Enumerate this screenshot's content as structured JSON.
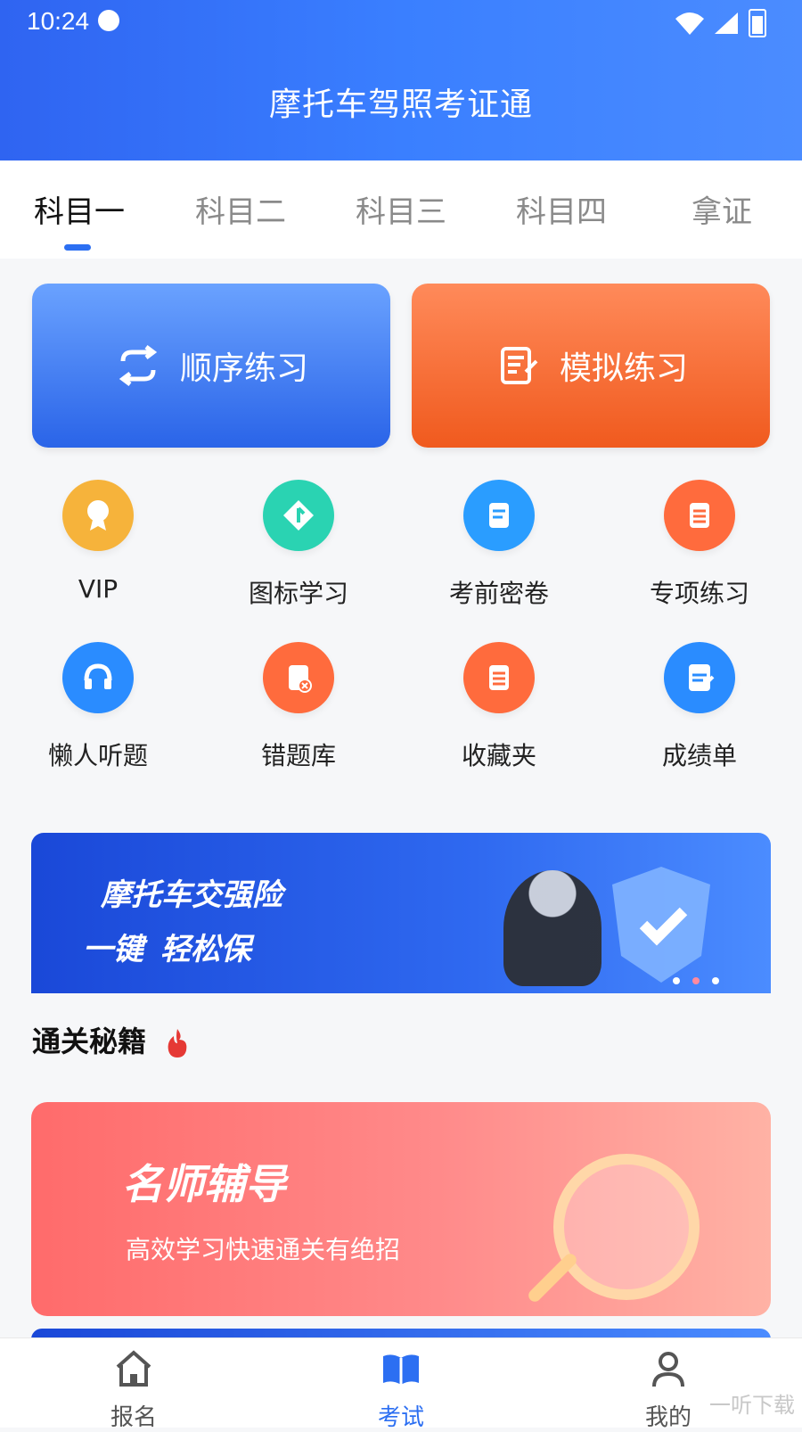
{
  "status": {
    "time": "10:24"
  },
  "header": {
    "title": "摩托车驾照考证通"
  },
  "tabs": [
    {
      "label": "科目一"
    },
    {
      "label": "科目二"
    },
    {
      "label": "科目三"
    },
    {
      "label": "科目四"
    },
    {
      "label": "拿证"
    }
  ],
  "actions": {
    "sequence": "顺序练习",
    "mock": "模拟练习"
  },
  "grid": [
    {
      "label": "VIP",
      "color": "#f6b33b"
    },
    {
      "label": "图标学习",
      "color": "#2ad3b2"
    },
    {
      "label": "考前密卷",
      "color": "#2a9dff"
    },
    {
      "label": "专项练习",
      "color": "#ff6b3d"
    },
    {
      "label": "懒人听题",
      "color": "#2a8cff"
    },
    {
      "label": "错题库",
      "color": "#ff6b3d"
    },
    {
      "label": "收藏夹",
      "color": "#ff6b3d"
    },
    {
      "label": "成绩单",
      "color": "#2a8cff"
    }
  ],
  "banner": {
    "line1": "摩托车交强险",
    "line2_prefix": "一键",
    "line2_main": "轻松保"
  },
  "section": {
    "title": "通关秘籍"
  },
  "card": {
    "title": "名师辅导",
    "subtitle": "高效学习快速通关有绝招"
  },
  "bottom_nav": [
    {
      "label": "报名"
    },
    {
      "label": "考试"
    },
    {
      "label": "我的"
    }
  ],
  "watermark": "一听下载"
}
